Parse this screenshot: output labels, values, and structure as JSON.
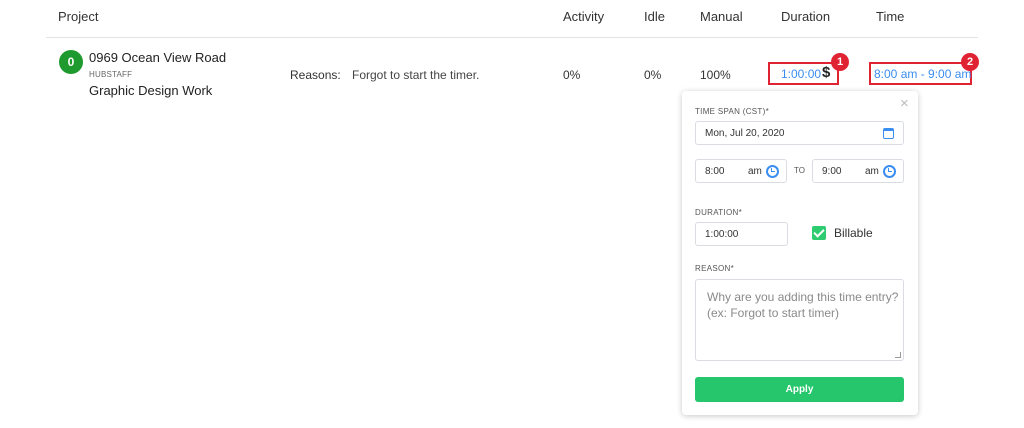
{
  "table": {
    "columns": {
      "project": "Project",
      "activity": "Activity",
      "idle": "Idle",
      "manual": "Manual",
      "duration": "Duration",
      "time": "Time"
    },
    "row": {
      "avatar_letter": "0",
      "project_name": "0969 Ocean View Road",
      "organization": "HUBSTAFF",
      "task": "Graphic Design Work",
      "reasons_label": "Reasons:",
      "reasons_text": "Forgot to start the timer.",
      "activity": "0%",
      "idle": "0%",
      "manual": "100%",
      "duration": "1:00:00",
      "billable_symbol": "$",
      "time_range": "8:00 am - 9:00 am"
    }
  },
  "markers": [
    "1",
    "2"
  ],
  "popover": {
    "close_glyph": "×",
    "time_span_label": "TIME SPAN (CST)*",
    "date_value": "Mon, Jul 20, 2020",
    "start_time": "8:00",
    "start_ampm": "am",
    "to_label": "TO",
    "end_time": "9:00",
    "end_ampm": "am",
    "duration_label": "DURATION*",
    "duration_value": "1:00:00",
    "billable_label": "Billable",
    "billable_checked": true,
    "reason_label": "REASON*",
    "reason_placeholder": "Why are you adding this time entry? (ex: Forgot to start timer)",
    "apply_label": "Apply"
  },
  "colors": {
    "accent_blue": "#3a8ef0",
    "highlight_red": "#e02333",
    "apply_green": "#26c66c",
    "avatar_green": "#1f9a2e"
  }
}
